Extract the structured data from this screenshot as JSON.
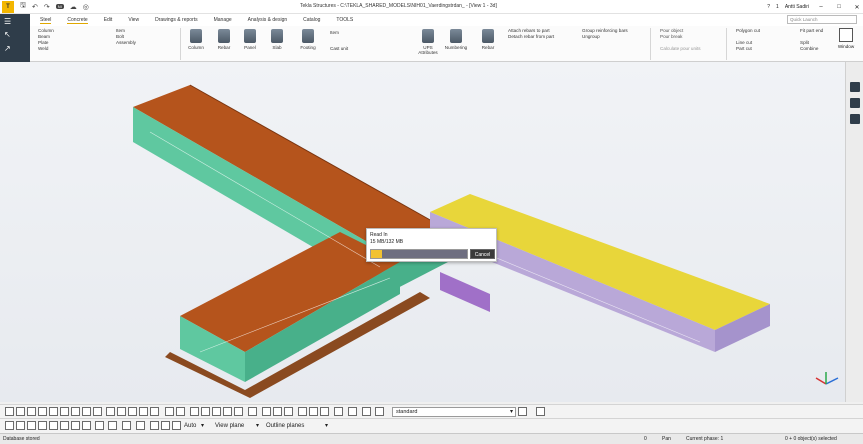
{
  "titlebar": {
    "title": "Tekla Structures - C:\\TEKLA_SHARED_MODELS\\NIH01_Vaerdingstrdan_ - [View 1 - 3d]",
    "user": "Antti Sadiri",
    "notification_count": "1",
    "quick_access_badge": "NI",
    "logo_letter": "T"
  },
  "menu": {
    "items": [
      "Steel",
      "Concrete",
      "Edit",
      "View",
      "Drawings & reports",
      "Manage",
      "Analysis & design",
      "Catalog",
      "TOOLS"
    ],
    "search_placeholder": "Quick Launch"
  },
  "ribbon": {
    "steel_items": [
      "Column",
      "Beam",
      "Plate",
      "Weld"
    ],
    "steel_items2": [
      "Bolt",
      "Assembly",
      "Item"
    ],
    "buttons": [
      "Column",
      "Rebar",
      "Panel",
      "Slab",
      "Footing",
      "Cast unit",
      "Item",
      "UPS Attributes",
      "Numbering",
      "Rebar"
    ],
    "rebar_actions": [
      "Attach rebars to part",
      "Detach rebar from part"
    ],
    "group_actions": [
      "Group reinforcing bars",
      "Ungroup"
    ],
    "pour_actions": [
      "Pour object",
      "Pour break",
      "Calculate pour units"
    ],
    "cut_actions": [
      "Polygon cut",
      "Line cut",
      "Part cut"
    ],
    "part_actions": [
      "Fit part end",
      "Split",
      "Combine"
    ],
    "window_label": "Window"
  },
  "dialog": {
    "title": "Read In",
    "size_text": "15 MB/132 MB",
    "progress": 0.11,
    "cancel_label": "Cancel"
  },
  "bottom_toolbar": {
    "filter_value": "standard",
    "auto_label": "Auto",
    "view_plane_label": "View plane",
    "outline_label": "Outline planes"
  },
  "status": {
    "left": "Database stored",
    "count": "0",
    "mode": "Pan",
    "phase": "Current phase: 1",
    "selection": "0 + 0 object(s) selected"
  },
  "colors": {
    "roof": "#b5541c",
    "wall": "#5fc8a0",
    "steel": "#e8d63a",
    "facade": "#b9a8d8",
    "ribbon_dark": "#2f3d4a",
    "accent": "#f1c232"
  }
}
